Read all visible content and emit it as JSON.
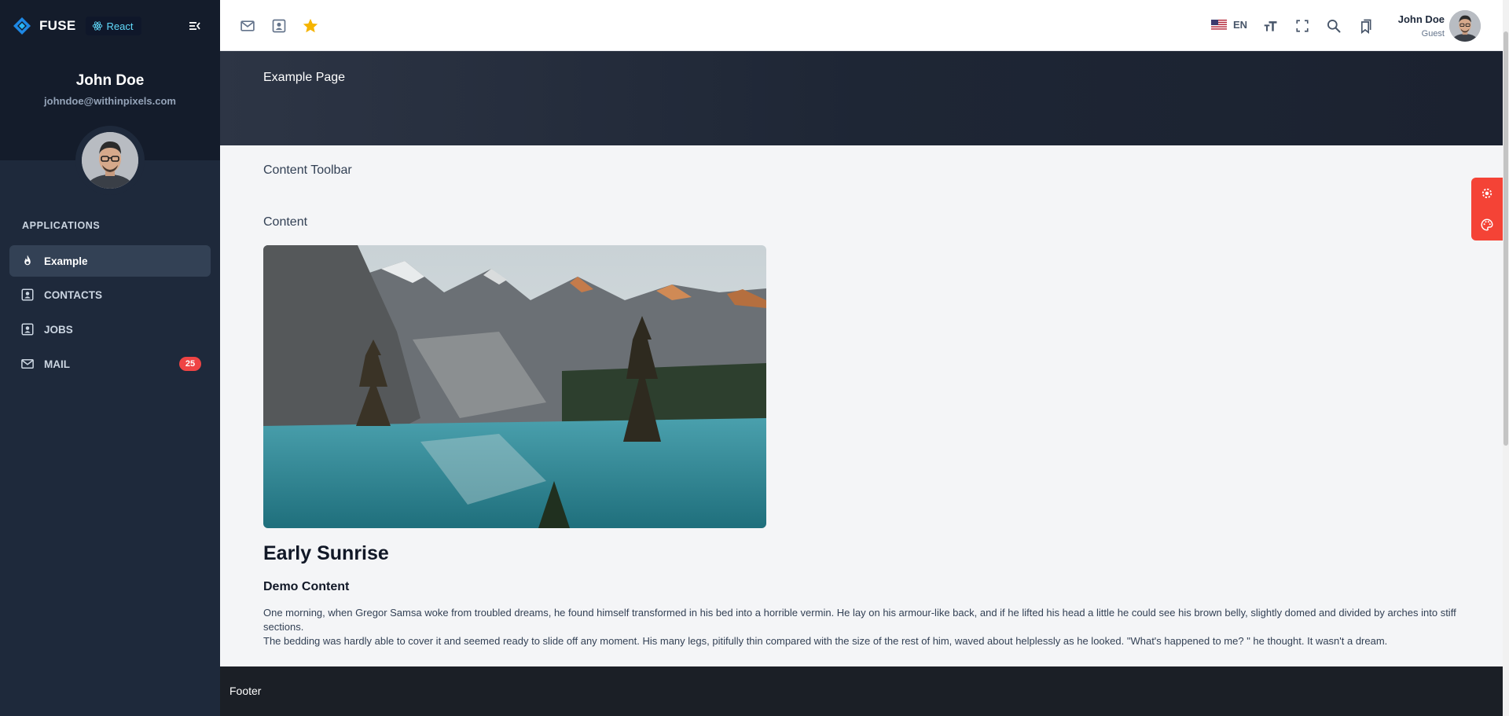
{
  "sidebar": {
    "brand": "FUSE",
    "badge": "React",
    "user": {
      "name": "John Doe",
      "email": "johndoe@withinpixels.com"
    },
    "section_title": "APPLICATIONS",
    "items": [
      {
        "label": "Example",
        "icon": "fire-icon",
        "active": true
      },
      {
        "label": "CONTACTS",
        "icon": "contact-card-icon"
      },
      {
        "label": "JOBS",
        "icon": "contact-card-icon"
      },
      {
        "label": "MAIL",
        "icon": "mail-icon",
        "badge": "25"
      }
    ]
  },
  "topbar": {
    "left_icons": [
      "mail-icon",
      "contact-card-icon",
      "star-icon"
    ],
    "language": "EN",
    "right_icons": [
      "font-size-icon",
      "fullscreen-icon",
      "search-icon",
      "bookmarks-icon"
    ],
    "user": {
      "name": "John Doe",
      "role": "Guest"
    }
  },
  "header": {
    "title": "Example Page"
  },
  "content": {
    "toolbar_label": "Content Toolbar",
    "content_label": "Content",
    "title": "Early Sunrise",
    "subtitle": "Demo Content",
    "paragraph1": "One morning, when Gregor Samsa woke from troubled dreams, he found himself transformed in his bed into a horrible vermin. He lay on his armour-like back, and if he lifted his head a little he could see his brown belly, slightly domed and divided by arches into stiff sections.",
    "paragraph2": "The bedding was hardly able to cover it and seemed ready to slide off any moment. His many legs, pitifully thin compared with the size of the rest of him, waved about helplessly as he looked. \"What's happened to me? \" he thought. It wasn't a dream."
  },
  "footer": {
    "label": "Footer"
  },
  "colors": {
    "sidebar_bg": "#1e293b",
    "accent_star": "#f5b400",
    "badge_red": "#ef4444",
    "panel_red": "#f44336"
  }
}
